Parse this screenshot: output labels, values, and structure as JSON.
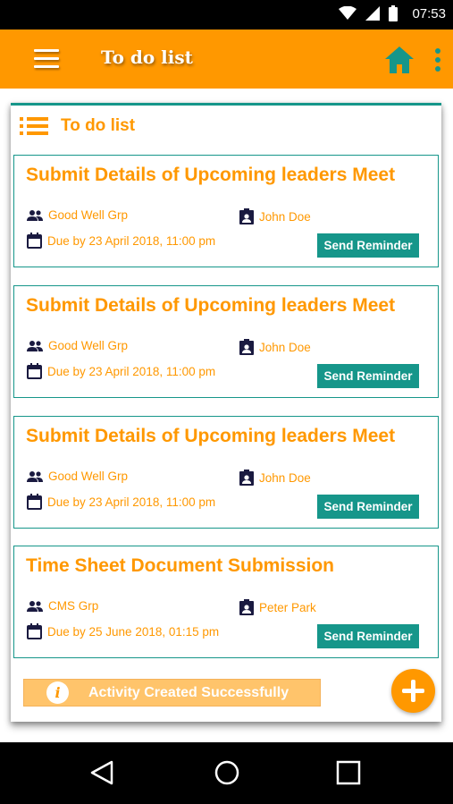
{
  "status_bar": {
    "time": "07:53"
  },
  "app_bar": {
    "title": "To do list"
  },
  "panel": {
    "title": "To do list"
  },
  "tasks": [
    {
      "title": "Submit Details of Upcoming leaders Meet",
      "group": "Good Well Grp",
      "assignee": "John Doe",
      "due": "Due by 23 April 2018, 11:00 pm",
      "button": "Send Reminder"
    },
    {
      "title": "Submit Details of Upcoming leaders Meet",
      "group": "Good Well Grp",
      "assignee": "John Doe",
      "due": "Due by 23 April 2018, 11:00 pm",
      "button": "Send Reminder"
    },
    {
      "title": "Submit Details of Upcoming leaders Meet",
      "group": "Good Well Grp",
      "assignee": "John Doe",
      "due": "Due by 23 April 2018, 11:00 pm",
      "button": "Send Reminder"
    },
    {
      "title": "Time Sheet Document Submission",
      "group": "CMS Grp",
      "assignee": "Peter Park",
      "due": "Due by 25 June 2018, 01:15 pm",
      "button": "Send Reminder"
    }
  ],
  "toast": {
    "message": "Activity Created Successfully",
    "icon": "info-icon"
  },
  "colors": {
    "accent": "#FF9800",
    "teal": "#16968a",
    "toast_bg": "#FFC46B"
  },
  "icons": [
    "menu-icon",
    "home-icon",
    "more-vert-icon",
    "list-icon",
    "group-icon",
    "assignee-icon",
    "calendar-icon",
    "plus-icon",
    "back-icon",
    "home-circle-icon",
    "recents-icon"
  ]
}
